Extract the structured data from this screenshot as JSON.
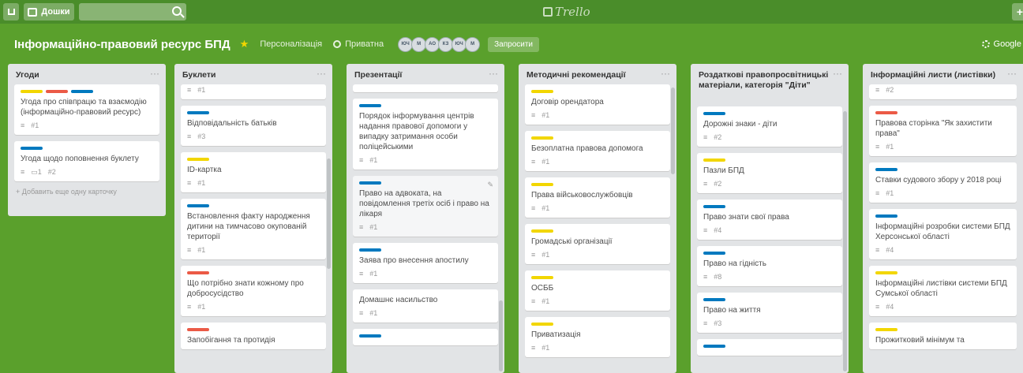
{
  "topbar": {
    "boards_label": "Дошки",
    "logo_text": "Trello",
    "plus_label": "+"
  },
  "board": {
    "title": "Інформаційно-правовий ресурс БПД",
    "personalize": "Персоналізація",
    "privacy": "Приватна",
    "members": [
      "ЮЧ",
      "М",
      "АО",
      "КЗ",
      "ЮЧ",
      "М"
    ],
    "invite": "Запросити",
    "menu": "Google"
  },
  "colors": {
    "yellow": "#f2d600",
    "red": "#eb5a46",
    "blue": "#0079bf",
    "green_bg": "#5aa02c"
  },
  "lists": [
    {
      "title": "Угоди",
      "cards": [
        {
          "labels": [
            "yellow",
            "red",
            "blue"
          ],
          "title": "Угода про співпрацю та взаємодію (інформаційно-правовий ресурс)",
          "badges": [
            "≡",
            "#1"
          ]
        },
        {
          "labels": [
            "blue"
          ],
          "title": "Угода щодо поповнення буклету",
          "badges": [
            "≡",
            "▭1",
            "#2"
          ]
        }
      ],
      "add": "+ Добавить еще одну карточку"
    },
    {
      "title": "Буклети",
      "cards": [
        {
          "labels": [],
          "title": "",
          "badges": [
            "≡",
            "#1"
          ]
        },
        {
          "labels": [
            "blue"
          ],
          "title": "Відповідальність батьків",
          "badges": [
            "≡",
            "#3"
          ]
        },
        {
          "labels": [
            "yellow"
          ],
          "title": "ID-картка",
          "badges": [
            "≡",
            "#1"
          ]
        },
        {
          "labels": [
            "blue"
          ],
          "title": "Встановлення факту народження дитини на тимчасово окупованій території",
          "badges": [
            "≡",
            "#1"
          ]
        },
        {
          "labels": [
            "red"
          ],
          "title": "Що потрібно знати кожному про добросусідство",
          "badges": [
            "≡",
            "#1"
          ]
        },
        {
          "labels": [
            "red"
          ],
          "title": "Запобігання та протидія",
          "badges": []
        }
      ]
    },
    {
      "title": "Презентації",
      "cards": [
        {
          "labels": [],
          "title": "",
          "badges": []
        },
        {
          "labels": [
            "blue"
          ],
          "title": "Порядок інформування центрів надання правової допомоги у випадку затримання особи поліцейськими",
          "badges": [
            "≡",
            "#1"
          ]
        },
        {
          "labels": [
            "blue"
          ],
          "title": "Право на адвоката, на повідомлення третіх осіб і право на лікаря",
          "badges": [
            "≡",
            "#1"
          ]
        },
        {
          "labels": [
            "blue"
          ],
          "title": "Заява про внесення апостилу",
          "badges": [
            "≡",
            "#1"
          ]
        },
        {
          "labels": [],
          "title": "Домашнє насильство",
          "badges": [
            "≡",
            "#1"
          ]
        },
        {
          "labels": [
            "blue"
          ],
          "title": "",
          "badges": []
        }
      ]
    },
    {
      "title": "Методичні рекомендації",
      "cards": [
        {
          "labels": [
            "yellow"
          ],
          "title": "Договір орендатора",
          "badges": [
            "≡",
            "#1"
          ]
        },
        {
          "labels": [
            "yellow"
          ],
          "title": "Безоплатна правова допомога",
          "badges": [
            "≡",
            "#1"
          ]
        },
        {
          "labels": [
            "yellow"
          ],
          "title": "Права військовослужбовців",
          "badges": [
            "≡",
            "#1"
          ]
        },
        {
          "labels": [
            "yellow"
          ],
          "title": "Громадські організації",
          "badges": [
            "≡",
            "#1"
          ]
        },
        {
          "labels": [
            "yellow"
          ],
          "title": "ОСББ",
          "badges": [
            "≡",
            "#1"
          ]
        },
        {
          "labels": [
            "yellow"
          ],
          "title": "Приватизація",
          "badges": [
            "≡",
            "#1"
          ]
        }
      ]
    },
    {
      "title": "Роздаткові правопросвітницькі матеріали, категорія \"Діти\"",
      "cards": [
        {
          "labels": [
            "blue"
          ],
          "title": "Дорожні знаки - діти",
          "badges": [
            "≡",
            "#2"
          ]
        },
        {
          "labels": [
            "yellow"
          ],
          "title": "Пазли БПД",
          "badges": [
            "≡",
            "#2"
          ]
        },
        {
          "labels": [
            "blue"
          ],
          "title": "Право знати свої права",
          "badges": [
            "≡",
            "#4"
          ]
        },
        {
          "labels": [
            "blue"
          ],
          "title": "Право на гідність",
          "badges": [
            "≡",
            "#8"
          ]
        },
        {
          "labels": [
            "blue"
          ],
          "title": "Право на життя",
          "badges": [
            "≡",
            "#3"
          ]
        },
        {
          "labels": [
            "blue"
          ],
          "title": "",
          "badges": []
        }
      ]
    },
    {
      "title": "Інформаційні листи (листівки)",
      "cards": [
        {
          "labels": [],
          "title": "",
          "badges": [
            "≡",
            "#2"
          ]
        },
        {
          "labels": [
            "red"
          ],
          "title": "Правова сторінка \"Як захистити права\"",
          "badges": [
            "≡",
            "#1"
          ]
        },
        {
          "labels": [
            "blue"
          ],
          "title": "Ставки судового збору у 2018 році",
          "badges": [
            "≡",
            "#1"
          ]
        },
        {
          "labels": [
            "blue"
          ],
          "title": "Інформаційні розробки системи БПД Херсонської області",
          "badges": [
            "≡",
            "#4"
          ]
        },
        {
          "labels": [
            "yellow"
          ],
          "title": "Інформаційні листівки системи БПД Сумської області",
          "badges": [
            "≡",
            "#4"
          ]
        },
        {
          "labels": [
            "yellow"
          ],
          "title": "Прожитковий мінімум та",
          "badges": []
        }
      ]
    }
  ]
}
